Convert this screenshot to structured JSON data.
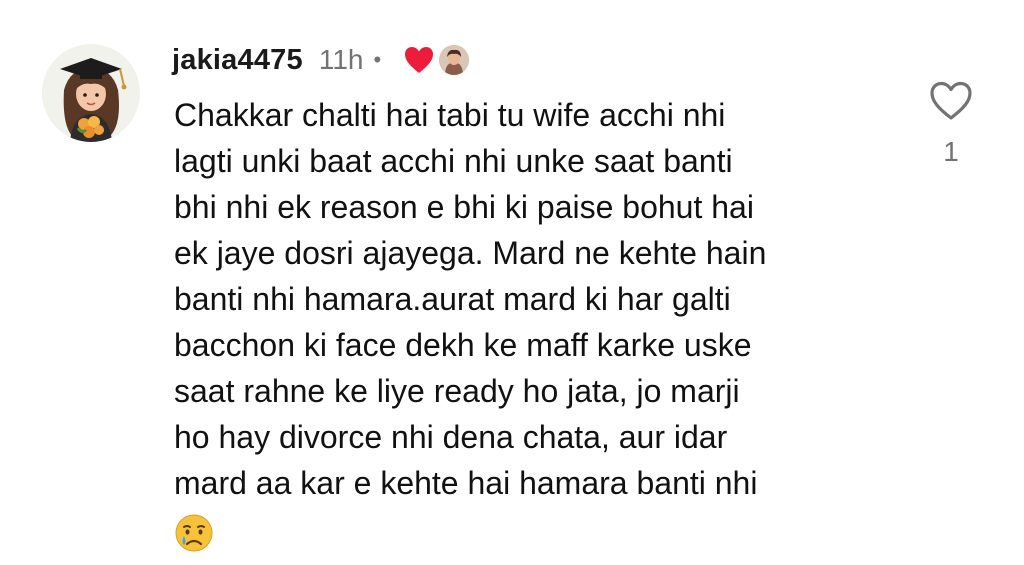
{
  "comment": {
    "username": "jakia4475",
    "time": "11h",
    "separator": "•",
    "author_liked_icon": "red-heart-icon",
    "text_lines": [
      "Chakkar chalti hai tabi tu wife acchi nhi",
      "lagti unki baat acchi nhi unke saat banti",
      "bhi nhi ek reason e bhi ki paise bohut hai",
      "ek jaye dosri ajayega. Mard ne kehte hain",
      "banti nhi hamara.aurat mard ki har galti",
      "bacchon ki face dekh ke maff karke uske",
      "saat rahne ke liye ready ho jata, jo marji",
      "ho hay divorce nhi dena chata, aur idar",
      "mard aa kar e kehte hai hamara banti nhi"
    ],
    "emoji": "crying-face-emoji",
    "like_icon": "heart-outline-icon",
    "like_count": "1"
  },
  "colors": {
    "text": "#111111",
    "muted": "#737373",
    "heart_red": "#ed1c3b",
    "background": "#ffffff"
  }
}
